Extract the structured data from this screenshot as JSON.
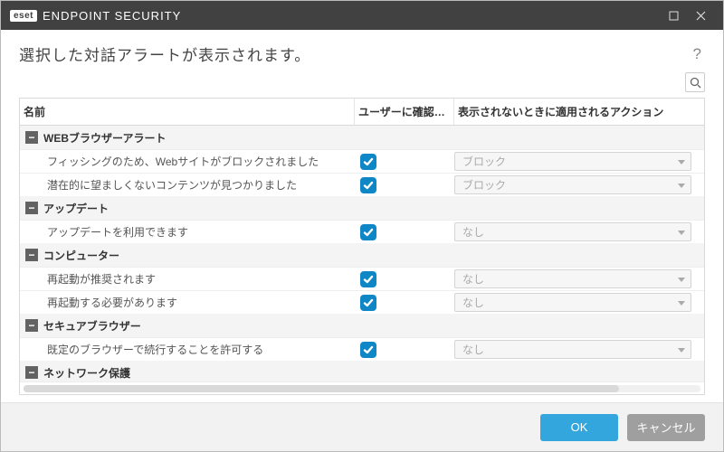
{
  "titlebar": {
    "brand_badge": "eset",
    "brand_text": "ENDPOINT SECURITY"
  },
  "subheader": {
    "title": "選択した対話アラートが表示されます。",
    "help": "?"
  },
  "table": {
    "headers": {
      "name": "名前",
      "ask": "ユーザーに確認する",
      "action": "表示されないときに適用されるアクション"
    },
    "groups": [
      {
        "label": "WEBブラウザーアラート",
        "rows": [
          {
            "name": "フィッシングのため、Webサイトがブロックされました",
            "ask": true,
            "action": "ブロック"
          },
          {
            "name": "潜在的に望ましくないコンテンツが見つかりました",
            "ask": true,
            "action": "ブロック"
          }
        ]
      },
      {
        "label": "アップデート",
        "rows": [
          {
            "name": "アップデートを利用できます",
            "ask": true,
            "action": "なし"
          }
        ]
      },
      {
        "label": "コンピューター",
        "rows": [
          {
            "name": "再起動が推奨されます",
            "ask": true,
            "action": "なし"
          },
          {
            "name": "再起動する必要があります",
            "ask": true,
            "action": "なし"
          }
        ]
      },
      {
        "label": "セキュアブラウザー",
        "rows": [
          {
            "name": "既定のブラウザーで続行することを許可する",
            "ask": true,
            "action": "なし"
          }
        ]
      },
      {
        "label": "ネットワーク保護",
        "rows": []
      }
    ]
  },
  "footer": {
    "ok": "OK",
    "cancel": "キャンセル"
  }
}
